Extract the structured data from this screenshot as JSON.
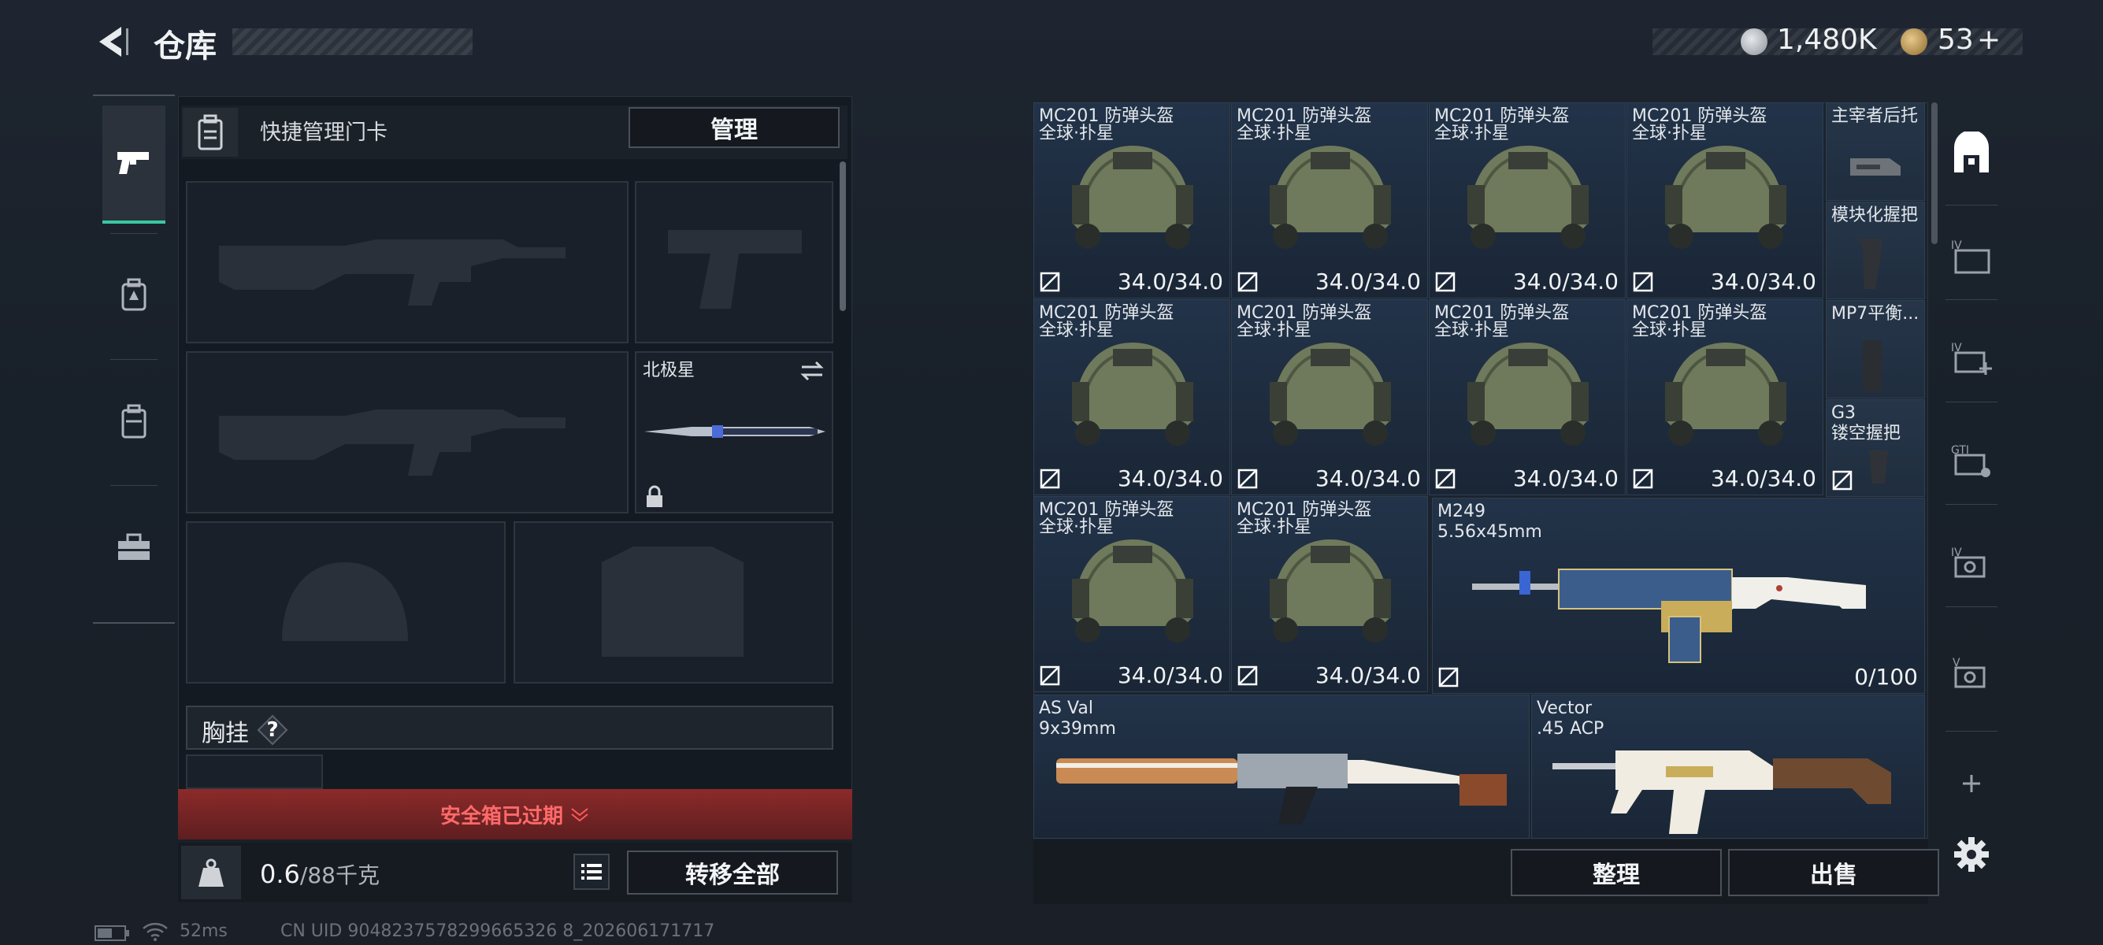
{
  "header": {
    "title": "仓库",
    "currency1": "1,480K",
    "currency2": "53",
    "currency2_plus": "+"
  },
  "colors": {
    "accent": "#3bc7a1",
    "expired_bg": "#7a2426",
    "expired_text": "#ff6a6a"
  },
  "left": {
    "card_label": "快捷管理门卡",
    "manage_button": "管理",
    "melee_name": "北极星",
    "chest_label": "胸挂",
    "chest_help": "?",
    "expired_text": "安全箱已过期",
    "weight_value": "0.6",
    "weight_max": "/88千克",
    "transfer_button": "转移全部"
  },
  "grid": {
    "helmets": [
      {
        "name1": "MC201 防弹头盔",
        "name2": "全球·扑星",
        "dur": "34.0/34.0"
      },
      {
        "name1": "MC201 防弹头盔",
        "name2": "全球·扑星",
        "dur": "34.0/34.0"
      },
      {
        "name1": "MC201 防弹头盔",
        "name2": "全球·扑星",
        "dur": "34.0/34.0"
      },
      {
        "name1": "MC201 防弹头盔",
        "name2": "全球·扑星",
        "dur": "34.0/34.0"
      },
      {
        "name1": "MC201 防弹头盔",
        "name2": "全球·扑星",
        "dur": "34.0/34.0"
      },
      {
        "name1": "MC201 防弹头盔",
        "name2": "全球·扑星",
        "dur": "34.0/34.0"
      },
      {
        "name1": "MC201 防弹头盔",
        "name2": "全球·扑星",
        "dur": "34.0/34.0"
      },
      {
        "name1": "MC201 防弹头盔",
        "name2": "全球·扑星",
        "dur": "34.0/34.0"
      },
      {
        "name1": "MC201 防弹头盔",
        "name2": "全球·扑星",
        "dur": "34.0/34.0"
      },
      {
        "name1": "MC201 防弹头盔",
        "name2": "全球·扑星",
        "dur": "34.0/34.0"
      }
    ],
    "side_items": [
      "主宰者后托",
      "模块化握把",
      "MP7平衡...",
      "G3",
      "镂空握把"
    ],
    "m249": {
      "name": "M249",
      "caliber": "5.56x45mm",
      "ammo": "0/100"
    },
    "asval": {
      "name": "AS Val",
      "caliber": "9x39mm"
    },
    "vector": {
      "name": "Vector",
      "caliber": ".45 ACP"
    },
    "sort_button": "整理",
    "sell_button": "出售"
  },
  "status": {
    "ping": "52ms",
    "uid": "CN UID 9048237578299665326 8_202606171717"
  }
}
